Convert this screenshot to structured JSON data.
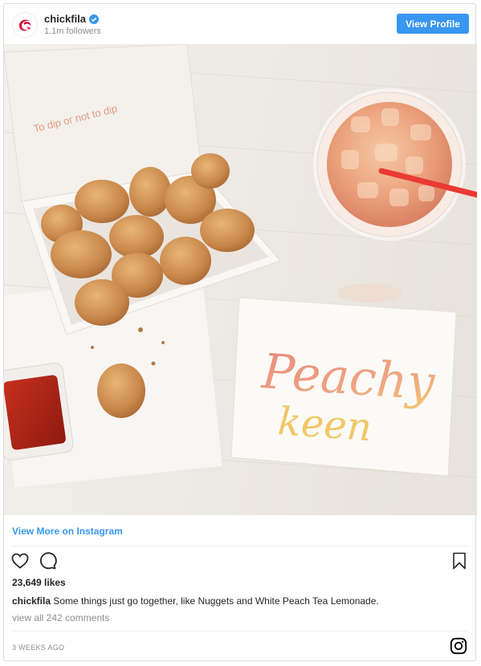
{
  "header": {
    "username": "chickfila",
    "followers": "1.1m followers",
    "view_profile_label": "View Profile"
  },
  "photo": {
    "box_text": "To dip or not to dip",
    "card_line1": "Peachy",
    "card_line2": "keen"
  },
  "links": {
    "view_more": "View More on Instagram"
  },
  "post": {
    "likes": "23,649 likes",
    "caption_user": "chickfila",
    "caption_text": " Some things just go together, like Nuggets and White Peach Tea Lemonade.",
    "comments": "view all 242 comments",
    "timestamp": "3 WEEKS AGO"
  },
  "icons": [
    "chickfila-logo-icon",
    "verified-icon",
    "heart-icon",
    "comment-icon",
    "bookmark-icon",
    "instagram-icon"
  ],
  "colors": {
    "accent": "#3897f0",
    "text": "#262626",
    "muted": "#8e8e8e"
  }
}
